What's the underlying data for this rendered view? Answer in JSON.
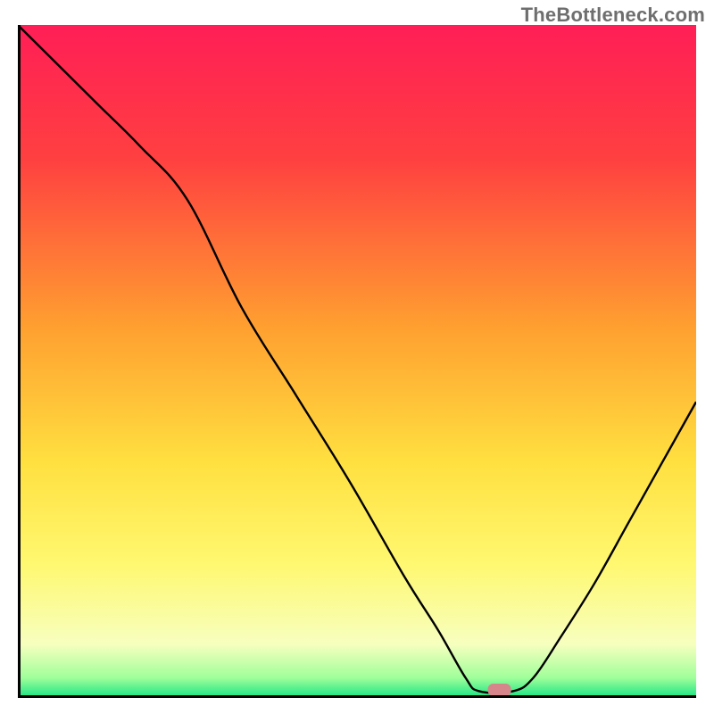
{
  "watermark": "TheBottleneck.com",
  "chart_data": {
    "type": "line",
    "title": "",
    "xlabel": "",
    "ylabel": "",
    "xlim": [
      0,
      100
    ],
    "ylim": [
      0,
      100
    ],
    "gradient_stops": [
      {
        "offset": 0,
        "color": "#ff1e56"
      },
      {
        "offset": 20,
        "color": "#ff4040"
      },
      {
        "offset": 45,
        "color": "#ffa030"
      },
      {
        "offset": 65,
        "color": "#ffe040"
      },
      {
        "offset": 80,
        "color": "#fff870"
      },
      {
        "offset": 92,
        "color": "#f7ffbf"
      },
      {
        "offset": 97,
        "color": "#a0ff9a"
      },
      {
        "offset": 100,
        "color": "#17e383"
      }
    ],
    "series": [
      {
        "name": "curve",
        "x": [
          0,
          6,
          12,
          18,
          25,
          33,
          41,
          49,
          57,
          62,
          66,
          68,
          73,
          76,
          80,
          85,
          90,
          95,
          100
        ],
        "y": [
          100,
          94,
          88,
          82,
          74,
          58,
          45,
          32,
          18,
          10,
          3,
          1,
          1,
          3,
          9,
          17,
          26,
          35,
          44
        ]
      }
    ],
    "marker": {
      "x": 71,
      "y": 1.2,
      "color": "#d6868a"
    },
    "axes_color": "#000000"
  }
}
